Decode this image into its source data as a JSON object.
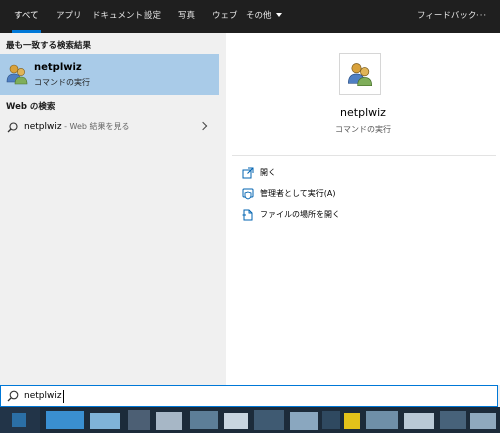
{
  "tabs": [
    {
      "label": "すべて",
      "active": true
    },
    {
      "label": "アプリ"
    },
    {
      "label": "ドキュメント"
    },
    {
      "label": "設定"
    },
    {
      "label": "写真"
    },
    {
      "label": "ウェブ"
    },
    {
      "label": "その他"
    }
  ],
  "header_right": {
    "feedback_label": "フィードバック",
    "more_label": "···"
  },
  "left_pane": {
    "best_match_heading": "最も一致する検索結果",
    "best_match": {
      "title": "netplwiz",
      "subtitle": "コマンドの実行",
      "icon": "users-icon"
    },
    "web_heading": "Web の検索",
    "web_result": {
      "query": "netplwiz",
      "hint": " - Web 結果を見る"
    }
  },
  "right_pane": {
    "title": "netplwiz",
    "subtitle": "コマンドの実行",
    "actions": [
      {
        "label": "開く",
        "icon": "open-icon"
      },
      {
        "label": "管理者として実行(A)",
        "icon": "shield-icon"
      },
      {
        "label": "ファイルの場所を開く",
        "icon": "file-location-icon"
      }
    ]
  },
  "search": {
    "value": "netplwiz"
  },
  "colors": {
    "accent": "#0078d7",
    "selected_item": "#a9cbe8",
    "header_bg": "#1f1f1f",
    "left_pane_bg": "#f0f0f0"
  }
}
